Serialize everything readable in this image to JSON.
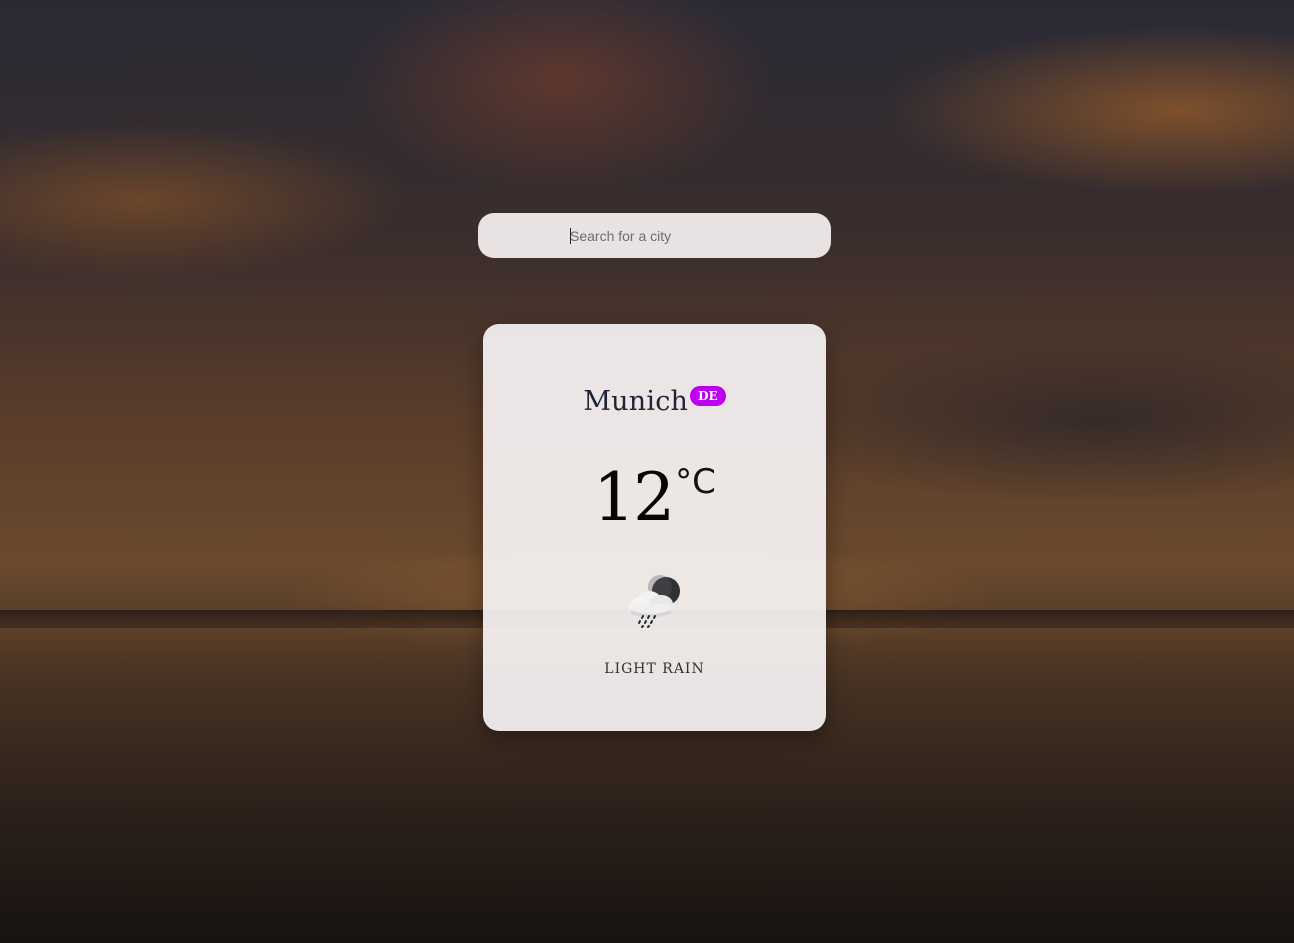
{
  "search": {
    "placeholder": "Search for a city",
    "value": ""
  },
  "weather": {
    "city": "Munich",
    "country": "DE",
    "temperature": "12",
    "unit": "°C",
    "icon": "light-rain-night-icon",
    "description": "LIGHT RAIN"
  },
  "colors": {
    "badge": "#bd00f0",
    "card_bg": "#f6f3f3",
    "search_bg": "#f5f0f0"
  }
}
